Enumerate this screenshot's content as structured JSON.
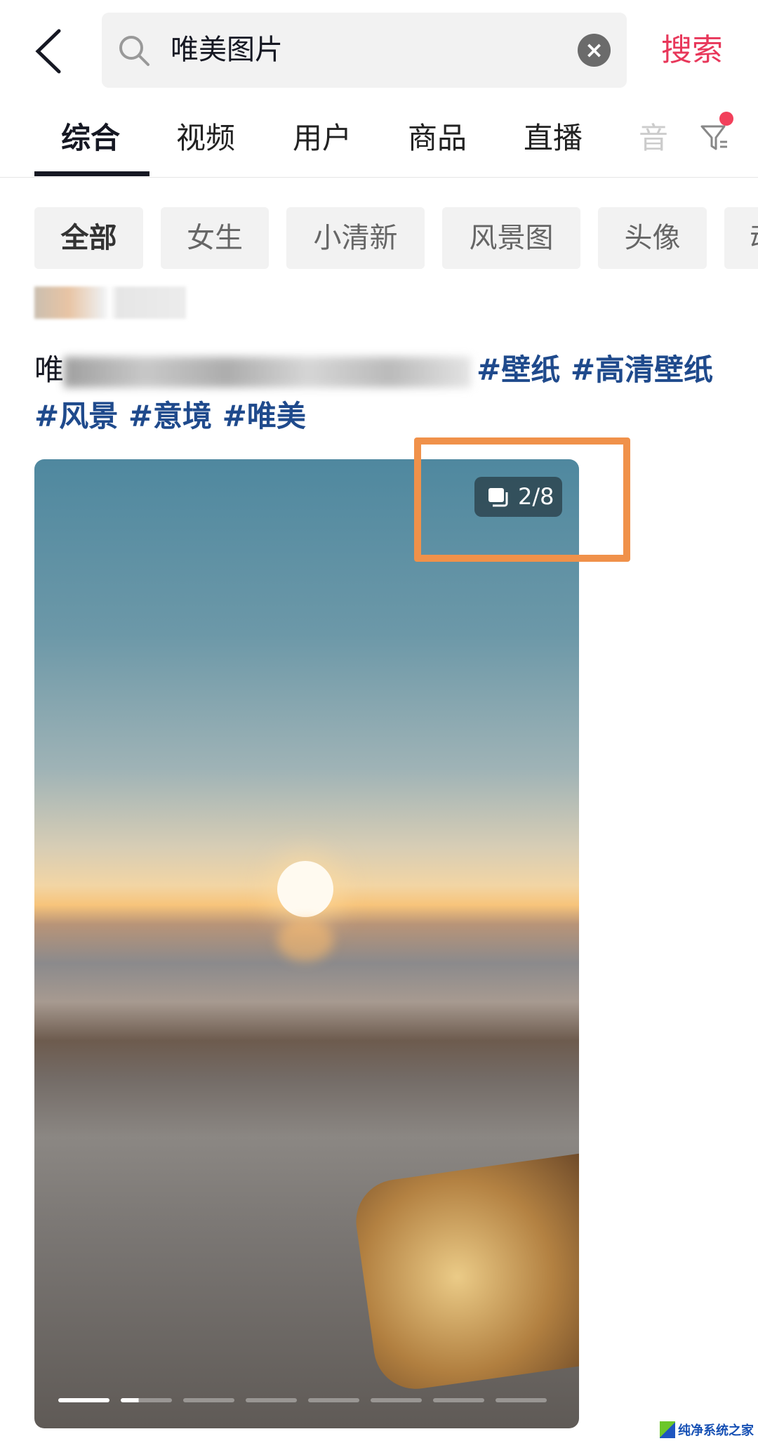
{
  "header": {
    "query": "唯美图片",
    "search_label": "搜索"
  },
  "tabs": [
    {
      "label": "综合",
      "active": true
    },
    {
      "label": "视频"
    },
    {
      "label": "用户"
    },
    {
      "label": "商品"
    },
    {
      "label": "直播"
    },
    {
      "label": "音"
    }
  ],
  "chips": [
    {
      "label": "全部",
      "active": true
    },
    {
      "label": "女生"
    },
    {
      "label": "小清新"
    },
    {
      "label": "风景图"
    },
    {
      "label": "头像"
    },
    {
      "label": "动"
    }
  ],
  "post": {
    "caption_prefix": "唯",
    "hashtags": "#壁纸 #高清壁纸 #风景 #意境 #唯美",
    "image_counter": "2/8",
    "current_image": 2,
    "total_images": 8
  },
  "colors": {
    "accent": "#e8375a",
    "hashtag": "#1f4a8c",
    "highlight": "#f0914a"
  },
  "watermark": "纯净系统之家"
}
